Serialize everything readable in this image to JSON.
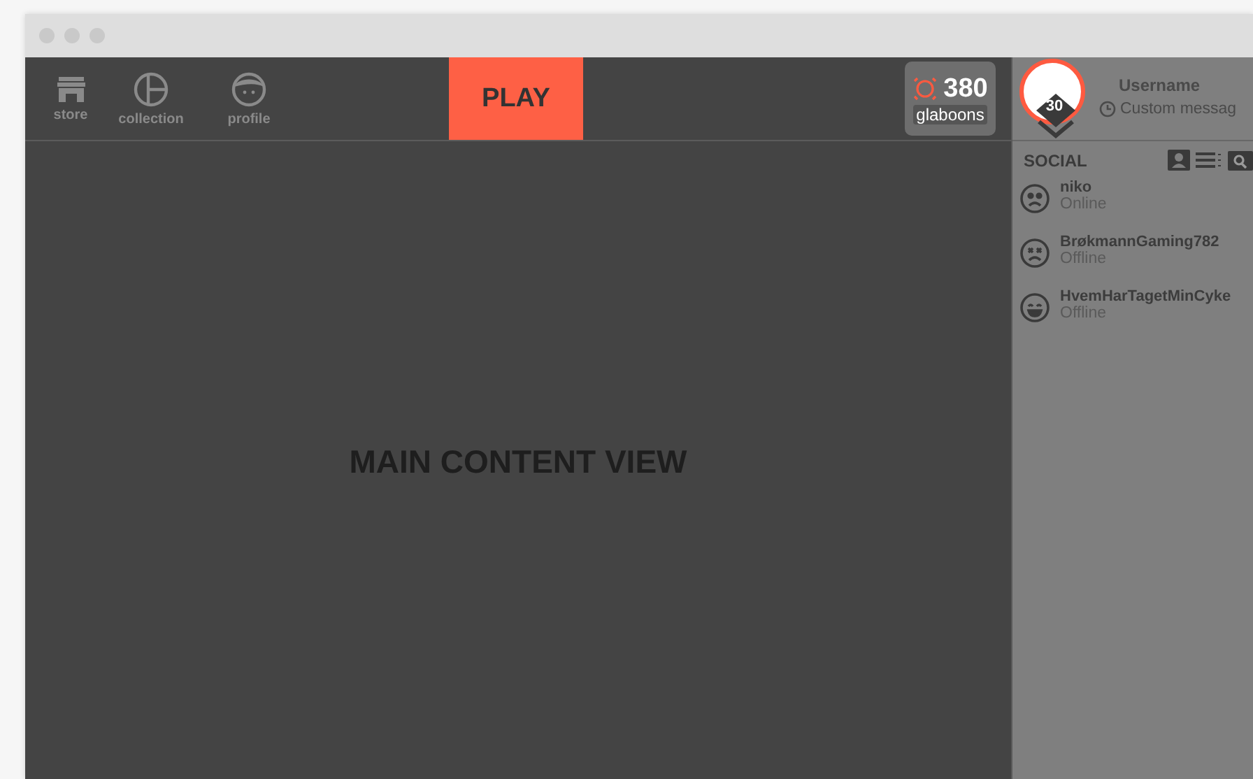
{
  "nav": [
    {
      "kind": "store",
      "label": "store"
    },
    {
      "kind": "collection",
      "label": "collection"
    },
    {
      "kind": "profile",
      "label": "profile"
    }
  ],
  "play_button": "PLAY",
  "currency": {
    "amount": "380",
    "label": "glaboons"
  },
  "user": {
    "level": "30",
    "name": "Username",
    "message": "Custom messag"
  },
  "main": {
    "placeholder_text": "MAIN CONTENT VIEW"
  },
  "social": {
    "title": "SOCIAL",
    "friends": [
      {
        "kind": "sad",
        "name": "niko",
        "status": "Online"
      },
      {
        "kind": "dizzy",
        "name": "BrøkmannGaming782",
        "status": "Offline"
      },
      {
        "kind": "happy",
        "name": "HvemHarTagetMinCyke",
        "status": "Offline"
      }
    ]
  }
}
